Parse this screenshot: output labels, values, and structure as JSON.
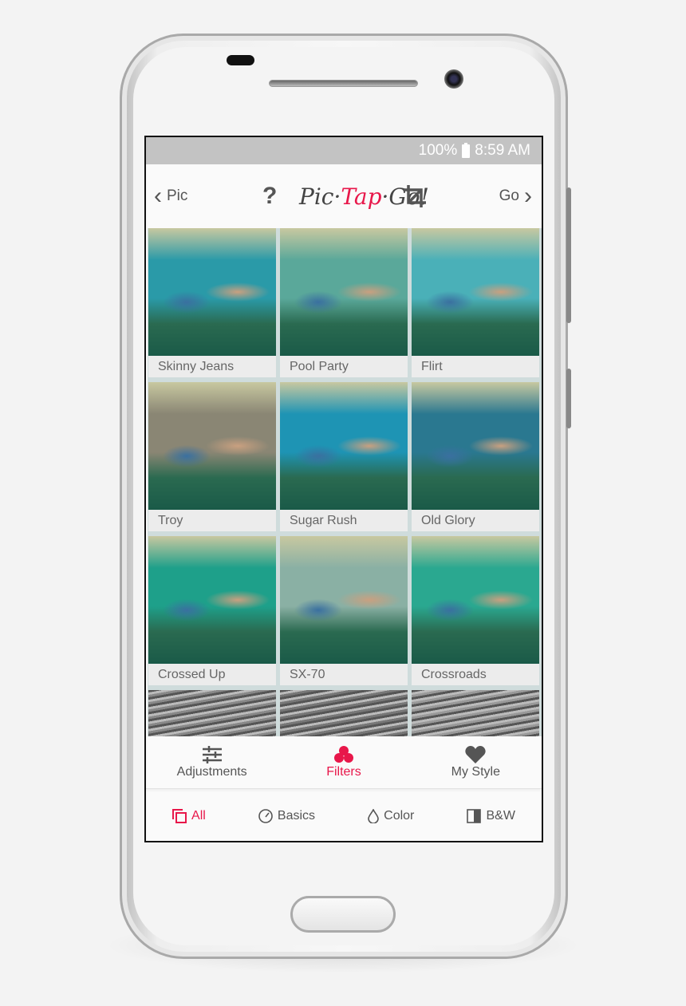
{
  "status": {
    "battery": "100%",
    "time": "8:59 AM"
  },
  "topbar": {
    "back_label": "Pic",
    "next_label": "Go",
    "logo": {
      "pic": "Pic",
      "tap": "Tap",
      "go": "Go!"
    },
    "help": "?"
  },
  "filters": [
    {
      "label": "Skinny Jeans",
      "tint": "#2a9aa8"
    },
    {
      "label": "Pool Party",
      "tint": "#5aa89a"
    },
    {
      "label": "Flirt",
      "tint": "#4ab0b8"
    },
    {
      "label": "Troy",
      "tint": "#8a8674"
    },
    {
      "label": "Sugar Rush",
      "tint": "#1e94b4"
    },
    {
      "label": "Old Glory",
      "tint": "#2a7890"
    },
    {
      "label": "Crossed Up",
      "tint": "#1ea08a"
    },
    {
      "label": "SX-70",
      "tint": "#8ab0a4"
    },
    {
      "label": "Crossroads",
      "tint": "#2aa890"
    },
    {
      "label": "",
      "tint": "#888888"
    },
    {
      "label": "",
      "tint": "#777777"
    },
    {
      "label": "",
      "tint": "#999999"
    }
  ],
  "bottom_tabs": [
    {
      "label": "Adjustments",
      "icon": "sliders-icon"
    },
    {
      "label": "Filters",
      "icon": "clover-icon",
      "active": true
    },
    {
      "label": "My Style",
      "icon": "heart-icon"
    }
  ],
  "sub_tabs": [
    {
      "label": "All",
      "icon": "copy-icon",
      "active": true
    },
    {
      "label": "Basics",
      "icon": "gauge-icon"
    },
    {
      "label": "Color",
      "icon": "drop-icon"
    },
    {
      "label": "B&W",
      "icon": "half-square-icon"
    }
  ],
  "colors": {
    "accent": "#e8174a",
    "status_bar": "#c3c3c3"
  }
}
